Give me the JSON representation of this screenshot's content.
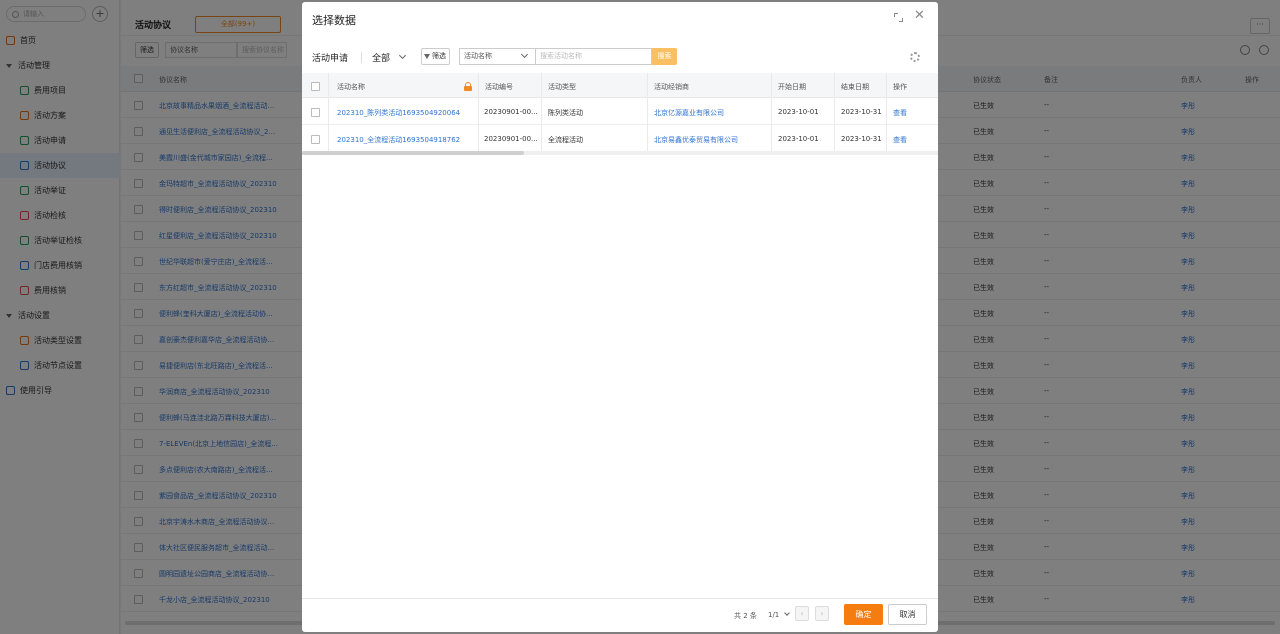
{
  "sidebar": {
    "search_placeholder": "请输入",
    "home": "首页",
    "groups": [
      {
        "label": "活动管理",
        "items": [
          "费用项目",
          "活动方案",
          "活动申请",
          "活动协议",
          "活动举证",
          "活动检核",
          "活动举证检核",
          "门店费用核销",
          "费用核销"
        ]
      },
      {
        "label": "活动设置",
        "items": [
          "活动类型设置",
          "活动节点设置"
        ]
      }
    ],
    "guide": "使用引导",
    "active_item": "活动协议"
  },
  "page": {
    "title": "活动协议",
    "tab_all": "全部(99+)",
    "filter_label": "筛选",
    "field_select": "协议名称",
    "field_input_placeholder": "搜索协议名称",
    "columns": {
      "name": "协议名称",
      "status": "协议状态",
      "note": "备注",
      "owner": "负责人",
      "action": "操作"
    },
    "rows": [
      "北京故事精品水果烟酒_全流程活动...",
      "通见生活便利店_全流程活动协议_2...",
      "美霞川盛(金代城市家园店)_全流程...",
      "金玛特超市_全流程活动协议_202310",
      "得时便利店_全流程活动协议_202310",
      "红星便利店_全流程活动协议_202310",
      "世纪华联超市(爱宁庄店)_全流程活...",
      "东方红超市_全流程活动协议_202310",
      "便利蜂(奎科大厦店)_全流程活动协...",
      "嘉创豪杰便利嘉华店_全流程活动协...",
      "易捷便利店(东北旺路店)_全流程活...",
      "华润商店_全流程活动协议_202310",
      "便利蜂(马连洼北路万霖科技大厦店)...",
      "7-ELEVEn(北京上地信园店)_全流程...",
      "多点便利店(农大南路店)_全流程活...",
      "紫园食品店_全流程活动协议_202310",
      "北京宇涛水木商店_全流程活动协议...",
      "体大社区便民服务超市_全流程活动...",
      "圆明园遗址公园商店_全流程活动协...",
      "千龙小店_全流程活动协议_202310"
    ],
    "row_status": "已生效",
    "row_note": "--",
    "row_owner": "李彤"
  },
  "modal": {
    "title": "选择数据",
    "subtitle": "活动申请",
    "scope": "全部",
    "filter_label": "筛选",
    "field_select": "活动名称",
    "search_placeholder": "搜索活动名称",
    "search_button": "搜索",
    "columns": [
      "活动名称",
      "活动编号",
      "活动类型",
      "活动经销商",
      "开始日期",
      "结束日期",
      "操作"
    ],
    "rows": [
      {
        "name": "202310_陈列类活动1693504920064",
        "code": "20230901-00...",
        "type": "陈列类活动",
        "dealer": "北京亿源嘉业有限公司",
        "start": "2023-10-01",
        "end": "2023-10-31",
        "action": "查看"
      },
      {
        "name": "202310_全流程活动1693504918762",
        "code": "20230901-00...",
        "type": "全流程活动",
        "dealer": "北京易鑫优泰贸易有限公司",
        "start": "2023-10-01",
        "end": "2023-10-31",
        "action": "查看"
      }
    ],
    "footer": {
      "total": "共 2 条",
      "pages": "1/1",
      "prev": "‹",
      "next": "›",
      "ok": "确定",
      "cancel": "取消"
    }
  },
  "colors": {
    "accent": "#f57c0f",
    "link": "#2f74d0"
  }
}
